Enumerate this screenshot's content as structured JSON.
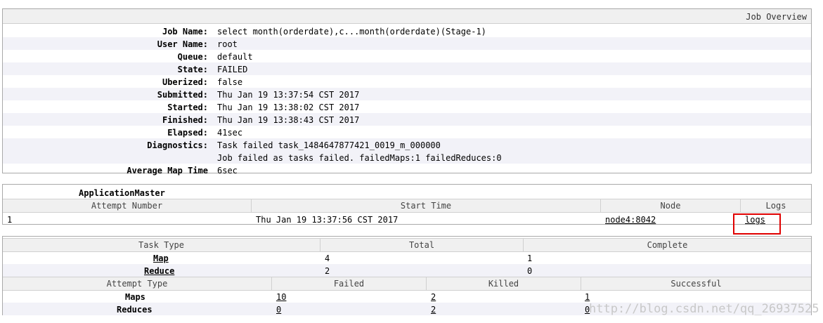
{
  "overview": {
    "header": "Job Overview",
    "rows": [
      {
        "label": "Job Name:",
        "value": "select month(orderdate),c...month(orderdate)(Stage-1)"
      },
      {
        "label": "User Name:",
        "value": "root"
      },
      {
        "label": "Queue:",
        "value": "default"
      },
      {
        "label": "State:",
        "value": "FAILED"
      },
      {
        "label": "Uberized:",
        "value": "false"
      },
      {
        "label": "Submitted:",
        "value": "Thu Jan 19 13:37:54 CST 2017"
      },
      {
        "label": "Started:",
        "value": "Thu Jan 19 13:38:02 CST 2017"
      },
      {
        "label": "Finished:",
        "value": "Thu Jan 19 13:38:43 CST 2017"
      },
      {
        "label": "Elapsed:",
        "value": "41sec"
      },
      {
        "label": "Diagnostics:",
        "value": "Task failed task_1484647877421_0019_m_000000",
        "value2": "Job failed as tasks failed. failedMaps:1 failedReduces:0"
      },
      {
        "label": "Average Map Time",
        "value": "6sec"
      }
    ]
  },
  "app_master": {
    "title": "ApplicationMaster",
    "headers": [
      "Attempt Number",
      "Start Time",
      "Node",
      "Logs"
    ],
    "row": {
      "attempt": "1",
      "start_time": "Thu Jan 19 13:37:56 CST 2017",
      "node": "node4:8042",
      "logs": "logs"
    }
  },
  "tasks": {
    "headers": [
      "Task Type",
      "Total",
      "Complete"
    ],
    "rows": [
      {
        "type": "Map",
        "total": "4",
        "complete": "1"
      },
      {
        "type": "Reduce",
        "total": "2",
        "complete": "0"
      }
    ]
  },
  "attempts": {
    "headers": [
      "Attempt Type",
      "Failed",
      "Killed",
      "Successful"
    ],
    "rows": [
      {
        "type": "Maps",
        "failed": "10",
        "killed": "2",
        "successful": "1"
      },
      {
        "type": "Reduces",
        "failed": "0",
        "killed": "2",
        "successful": "0"
      }
    ]
  },
  "watermark": "http://blog.csdn.net/qq_26937525",
  "colors": {
    "highlight_box": "#e00000",
    "alt_row": "#f2f2f8",
    "header_bg": "#f0f0f0"
  }
}
